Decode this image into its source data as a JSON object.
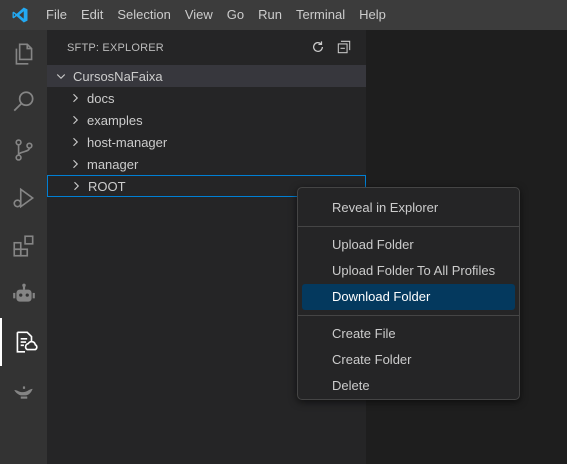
{
  "menubar": {
    "items": [
      "File",
      "Edit",
      "Selection",
      "View",
      "Go",
      "Run",
      "Terminal",
      "Help"
    ]
  },
  "activitybar": {
    "icons": [
      "files-icon",
      "search-icon",
      "source-control-icon",
      "run-debug-icon",
      "extensions-icon",
      "robot-icon",
      "sftp-explorer-icon",
      "genie-lamp-icon"
    ],
    "active": "sftp-explorer-icon"
  },
  "sidebar": {
    "title": "SFTP: EXPLORER",
    "root": "CursosNaFaixa",
    "items": [
      "docs",
      "examples",
      "host-manager",
      "manager",
      "ROOT"
    ],
    "focused": "ROOT"
  },
  "context_menu": {
    "group1": [
      "Reveal in Explorer"
    ],
    "group2": [
      "Upload Folder",
      "Upload Folder To All Profiles",
      "Download Folder"
    ],
    "group3": [
      "Create File",
      "Create Folder",
      "Delete"
    ],
    "selected": "Download Folder"
  },
  "colors": {
    "accent": "#007fd4",
    "selection": "#04395e",
    "logo": "#23a9f2"
  }
}
